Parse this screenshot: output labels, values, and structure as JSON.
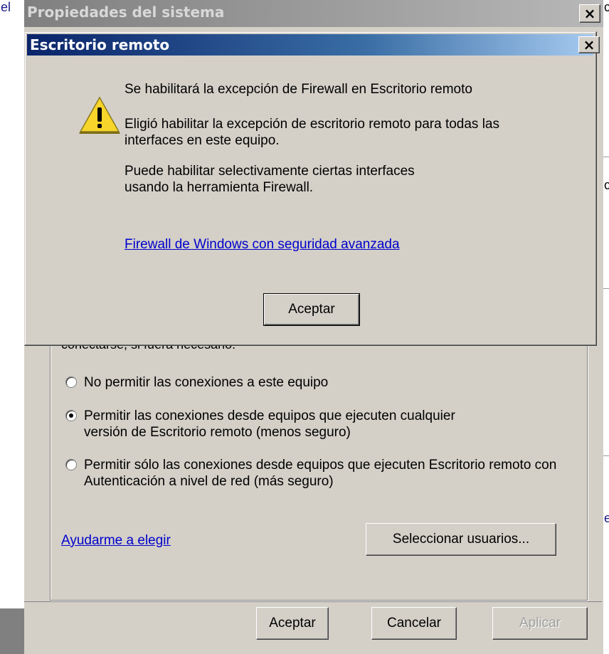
{
  "background": {
    "left_fragment": "el",
    "right_fragments": [
      "c",
      "c",
      "e"
    ]
  },
  "parent_window": {
    "title": "Propiedades del sistema",
    "close_glyph": "×",
    "partial_text": "conectarse, si fuera necesario:",
    "radio_options": [
      {
        "label": "No permitir las conexiones a este equipo",
        "checked": false
      },
      {
        "label": "Permitir las conexiones desde equipos que ejecuten cualquier versión de Escritorio remoto (menos seguro)",
        "checked": true
      },
      {
        "label": "Permitir sólo las conexiones desde equipos que ejecuten Escritorio remoto con Autenticación a nivel de red (más seguro)",
        "checked": false
      }
    ],
    "help_link": "Ayudarme a elegir",
    "select_users_button": "Seleccionar usuarios...",
    "buttons": {
      "ok": "Aceptar",
      "cancel": "Cancelar",
      "apply": "Aplicar"
    }
  },
  "dialog": {
    "title": "Escritorio remoto",
    "close_glyph": "×",
    "icon": "warning-icon",
    "heading": "Se habilitará la excepción de Firewall en Escritorio remoto",
    "paragraph1": "Eligió habilitar la excepción de escritorio remoto para todas las interfaces en este equipo.",
    "paragraph2": "Puede habilitar selectivamente ciertas interfaces usando la herramienta Firewall.",
    "link": "Firewall de Windows con seguridad avanzada",
    "ok_button": "Aceptar"
  },
  "colors": {
    "face": "#d4d0c8",
    "active_title_start": "#0a246a",
    "active_title_end": "#a6caf0",
    "link": "#0000cc"
  }
}
